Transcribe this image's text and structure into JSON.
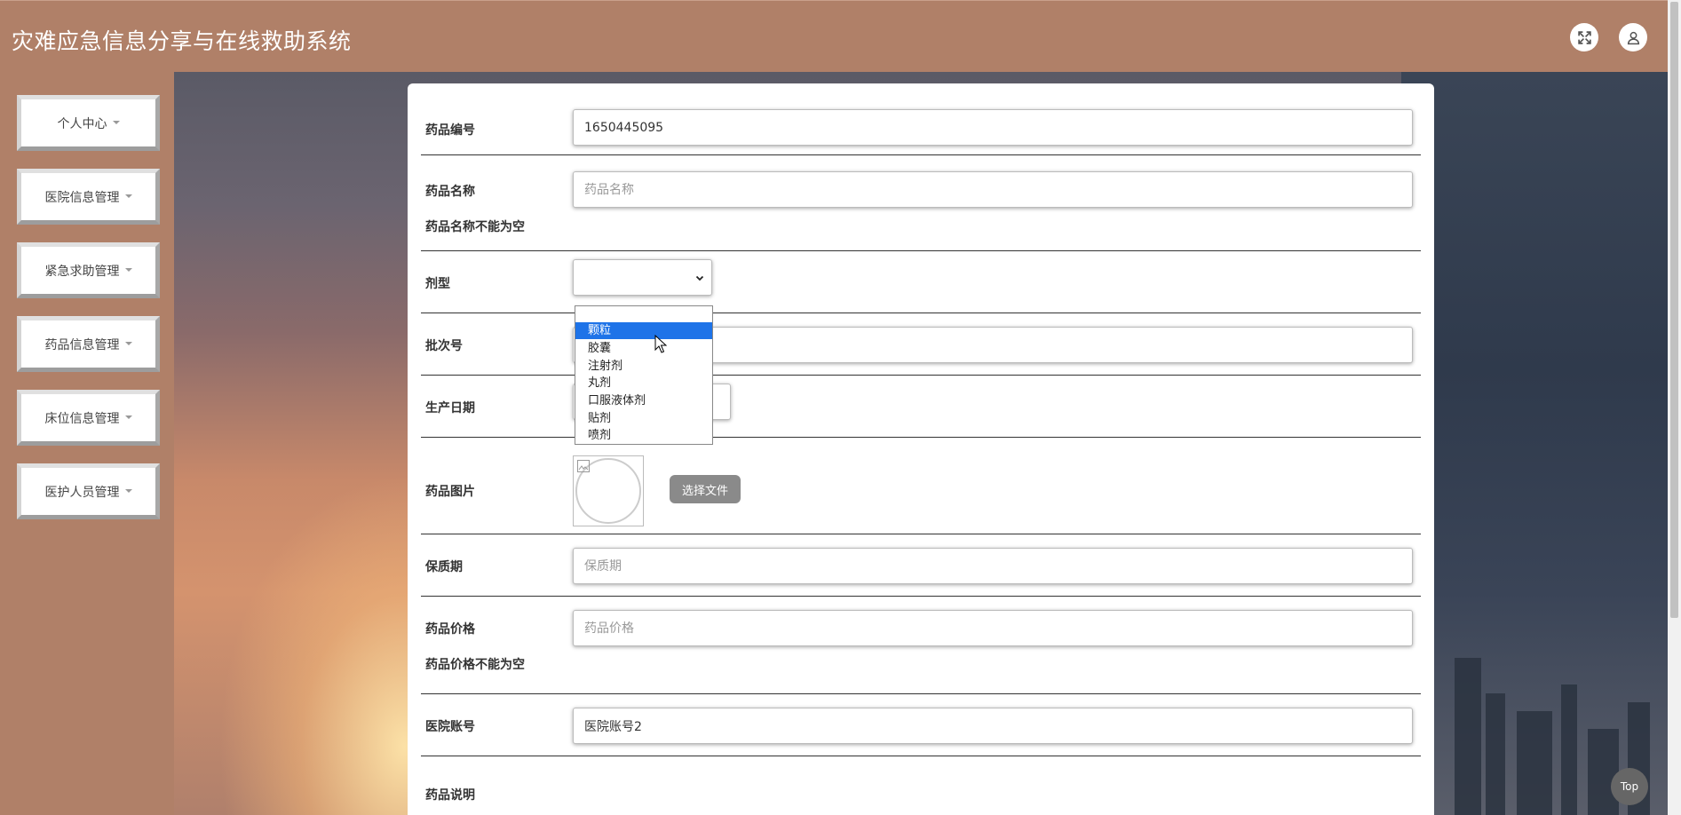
{
  "header": {
    "title": "灾难应急信息分享与在线救助系统",
    "fullscreen_icon": "fullscreen-icon",
    "user_icon": "user-icon"
  },
  "sidebar": {
    "items": [
      {
        "label": "个人中心"
      },
      {
        "label": "医院信息管理"
      },
      {
        "label": "紧急求助管理"
      },
      {
        "label": "药品信息管理"
      },
      {
        "label": "床位信息管理"
      },
      {
        "label": "医护人员管理"
      }
    ]
  },
  "form": {
    "drug_no": {
      "label": "药品编号",
      "value": "1650445095"
    },
    "drug_name": {
      "label": "药品名称",
      "placeholder": "药品名称",
      "error": "药品名称不能为空"
    },
    "dosage_form": {
      "label": "剂型",
      "value": "",
      "options": [
        "",
        "颗粒",
        "胶囊",
        "注射剂",
        "丸剂",
        "口服液体剂",
        "贴剂",
        "喷剂"
      ],
      "highlighted": "颗粒"
    },
    "batch_no": {
      "label": "批次号"
    },
    "production_date": {
      "label": "生产日期"
    },
    "drug_image": {
      "label": "药品图片",
      "button": "选择文件"
    },
    "shelf_life": {
      "label": "保质期",
      "placeholder": "保质期"
    },
    "drug_price": {
      "label": "药品价格",
      "placeholder": "药品价格",
      "error": "药品价格不能为空"
    },
    "hospital_account": {
      "label": "医院账号",
      "value": "医院账号2"
    },
    "drug_description": {
      "label": "药品说明"
    }
  },
  "top_button": {
    "label": "Top"
  },
  "colors": {
    "header_bg": "#b08068",
    "selected_option": "#1e73e8",
    "file_button": "#8a8a8a"
  }
}
